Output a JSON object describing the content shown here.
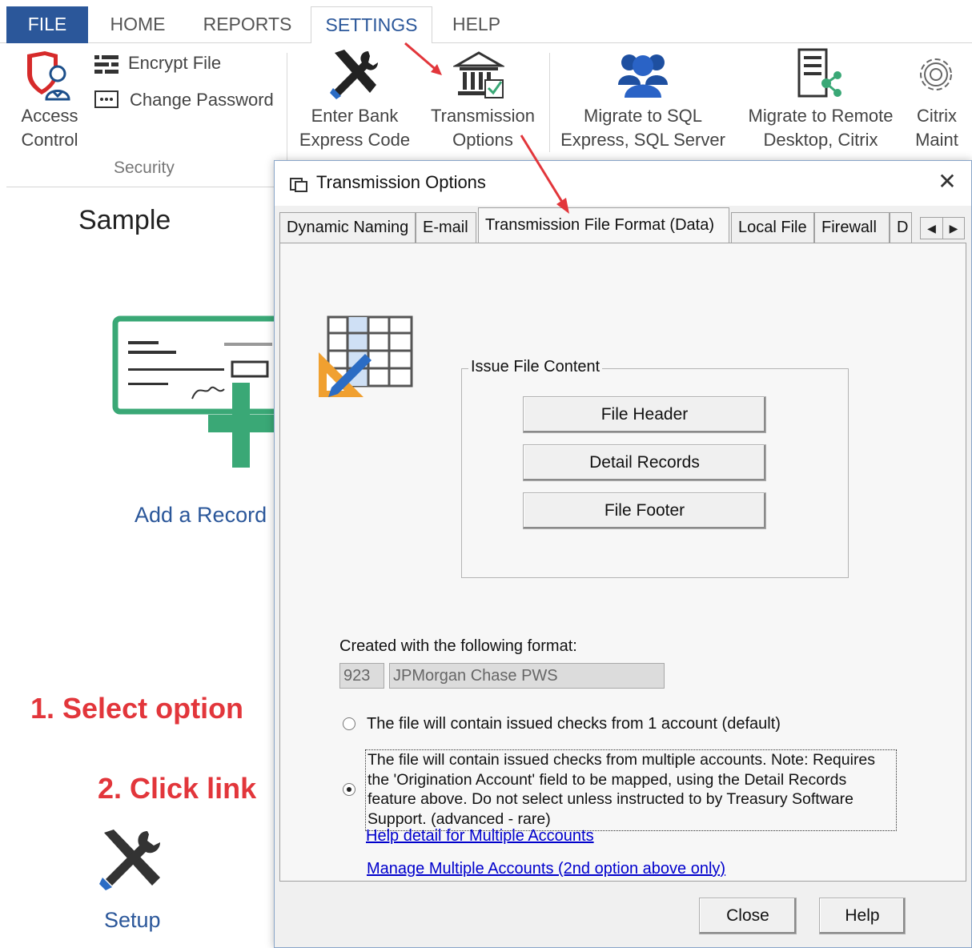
{
  "ribbon": {
    "tabs": [
      "FILE",
      "HOME",
      "REPORTS",
      "SETTINGS",
      "HELP"
    ],
    "active_tab": "SETTINGS",
    "security": {
      "access_line1": "Access",
      "access_line2": "Control",
      "encrypt": "Encrypt File",
      "change_password": "Change Password",
      "group_label": "Security"
    },
    "bank_line1": "Enter Bank",
    "bank_line2": "Express Code",
    "trans_line1": "Transmission",
    "trans_line2": "Options",
    "sql_line1": "Migrate to SQL",
    "sql_line2": "Express, SQL Server",
    "remote_line1": "Migrate to Remote",
    "remote_line2": "Desktop, Citrix",
    "citrix_line1": "Citrix",
    "citrix_line2": "Maint"
  },
  "background": {
    "title": "Sample",
    "add_record": "Add a Record",
    "setup": "Setup"
  },
  "dialog": {
    "title": "Transmission Options",
    "close_glyph": "✕",
    "tabs": [
      "Dynamic Naming",
      "E-mail",
      "Transmission File Format (Data)",
      "Local File",
      "Firewall",
      "D"
    ],
    "selected_tab": "Transmission File Format (Data)",
    "issue_group_label": "Issue File Content",
    "file_header": "File Header",
    "detail_records": "Detail Records",
    "file_footer": "File Footer",
    "created_label": "Created with the following format:",
    "format_code": "923",
    "format_name": "JPMorgan Chase PWS",
    "option1": "The file will contain issued checks from 1 account (default)",
    "option2": "The file will contain issued checks from multiple accounts.  Note: Requires the 'Origination Account' field to be mapped, using the Detail Records feature above.  Do not select unless instructed to by Treasury Software Support. (advanced - rare)",
    "selected_option": 2,
    "link_manage": "Manage Multiple Accounts (2nd option above only)",
    "link_help": "Help detail for Multiple Accounts",
    "close_button": "Close",
    "help_button": "Help"
  },
  "annotations": {
    "step1": "1. Select option",
    "step2": "2. Click link"
  },
  "colors": {
    "ribbon_blue": "#2b579a",
    "annotation_red": "#e2363b",
    "link_blue": "#0000cc",
    "check_green": "#3aa876"
  }
}
